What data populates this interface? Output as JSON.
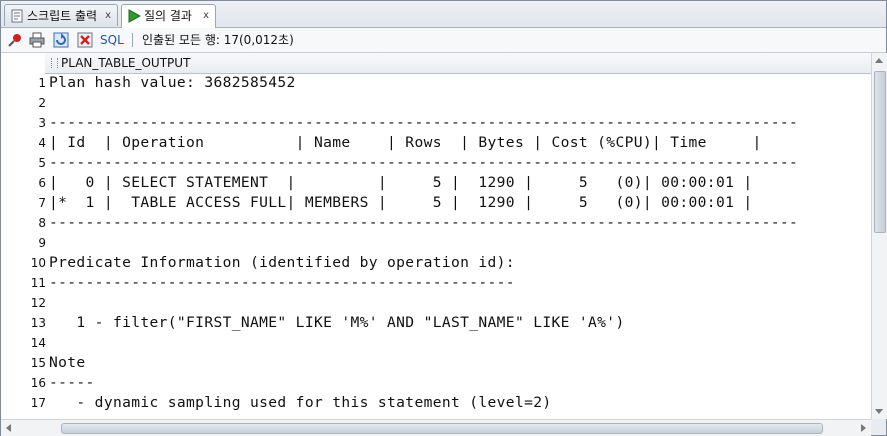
{
  "tabs": [
    {
      "label": "스크립트 출력",
      "icon": "script-icon",
      "close": "x"
    },
    {
      "label": "질의 결과",
      "icon": "run-icon",
      "close": "x",
      "active": true
    }
  ],
  "toolbar": {
    "icons": [
      "pin-icon",
      "print-icon",
      "refresh-icon",
      "clear-icon"
    ],
    "sql_label": "SQL",
    "status": "인출된 모든 행: 17(0,012초)"
  },
  "grid": {
    "column_header": "PLAN_TABLE_OUTPUT",
    "rows": [
      {
        "n": "1",
        "text": "Plan hash value: 3682585452"
      },
      {
        "n": "2",
        "text": ""
      },
      {
        "n": "3",
        "text": "----------------------------------------------------------------------------------"
      },
      {
        "n": "4",
        "text": "| Id  | Operation          | Name    | Rows  | Bytes | Cost (%CPU)| Time     |"
      },
      {
        "n": "5",
        "text": "----------------------------------------------------------------------------------"
      },
      {
        "n": "6",
        "text": "|   0 | SELECT STATEMENT  |         |     5 |  1290 |     5   (0)| 00:00:01 |"
      },
      {
        "n": "7",
        "text": "|*  1 |  TABLE ACCESS FULL| MEMBERS |     5 |  1290 |     5   (0)| 00:00:01 |"
      },
      {
        "n": "8",
        "text": "----------------------------------------------------------------------------------"
      },
      {
        "n": "9",
        "text": ""
      },
      {
        "n": "10",
        "text": "Predicate Information (identified by operation id):"
      },
      {
        "n": "11",
        "text": "---------------------------------------------------"
      },
      {
        "n": "12",
        "text": ""
      },
      {
        "n": "13",
        "text": "   1 - filter(\"FIRST_NAME\" LIKE 'M%' AND \"LAST_NAME\" LIKE 'A%')"
      },
      {
        "n": "14",
        "text": ""
      },
      {
        "n": "15",
        "text": "Note"
      },
      {
        "n": "16",
        "text": "-----"
      },
      {
        "n": "17",
        "text": "   - dynamic sampling used for this statement (level=2)"
      }
    ]
  },
  "colors": {
    "sql_link": "#1a56b8",
    "run_icon": "#2e9b2e",
    "pin_icon": "#cc2222"
  }
}
